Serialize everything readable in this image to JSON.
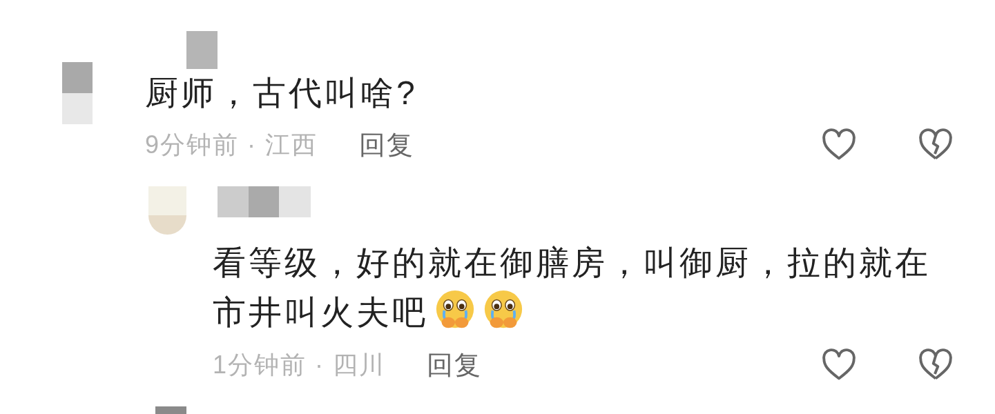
{
  "comments": [
    {
      "lines": [
        "厨师，古代叫啥?"
      ],
      "meta": "9分钟前 · 江西",
      "reply_label": "回复",
      "replies": [
        {
          "lines": [
            "看等级，好的就在御膳房，叫御厨，拉的就在",
            "市井叫火夫吧"
          ],
          "emojis": [
            {
              "kind": "crying-face"
            },
            {
              "kind": "crying-face"
            }
          ],
          "meta": "1分钟前 · 四川",
          "reply_label": "回复"
        }
      ]
    }
  ]
}
